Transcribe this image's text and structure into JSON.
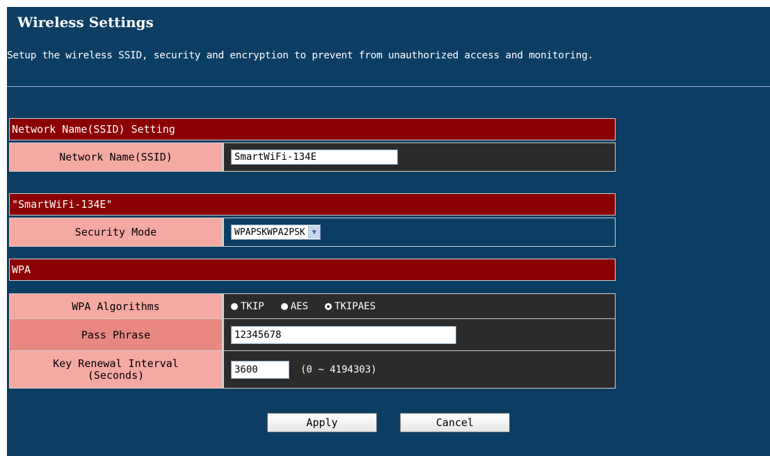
{
  "page": {
    "title": "Wireless Settings",
    "description": "Setup the wireless SSID, security and encryption to prevent from unauthorized access and monitoring."
  },
  "ssid_section": {
    "header": "Network Name(SSID) Setting",
    "name_label": "Network Name(SSID)",
    "name_value": "SmartWiFi-134E"
  },
  "security_section": {
    "header": "\"SmartWiFi-134E\"",
    "mode_label": "Security Mode",
    "mode_value": "WPAPSKWPA2PSK"
  },
  "wpa_section": {
    "header": "WPA",
    "algorithms_label": "WPA Algorithms",
    "algorithms": [
      {
        "label": "TKIP",
        "checked": false
      },
      {
        "label": "AES",
        "checked": false
      },
      {
        "label": "TKIPAES",
        "checked": true
      }
    ],
    "passphrase_label": "Pass Phrase",
    "passphrase_value": "12345678",
    "renewal_label_line1": "Key Renewal Interval",
    "renewal_label_line2": "(Seconds)",
    "renewal_value": "3600",
    "renewal_hint": "(0 ~ 4194303)"
  },
  "buttons": {
    "apply": "Apply",
    "cancel": "Cancel"
  },
  "colors": {
    "page_background": "#0c3e63",
    "section_header": "#8b0000",
    "label_cell": "#f5a9a3",
    "value_cell": "#2b2b2b"
  },
  "icons": {
    "select_arrow": "chevron-down-icon",
    "radio": "radio-icon"
  }
}
